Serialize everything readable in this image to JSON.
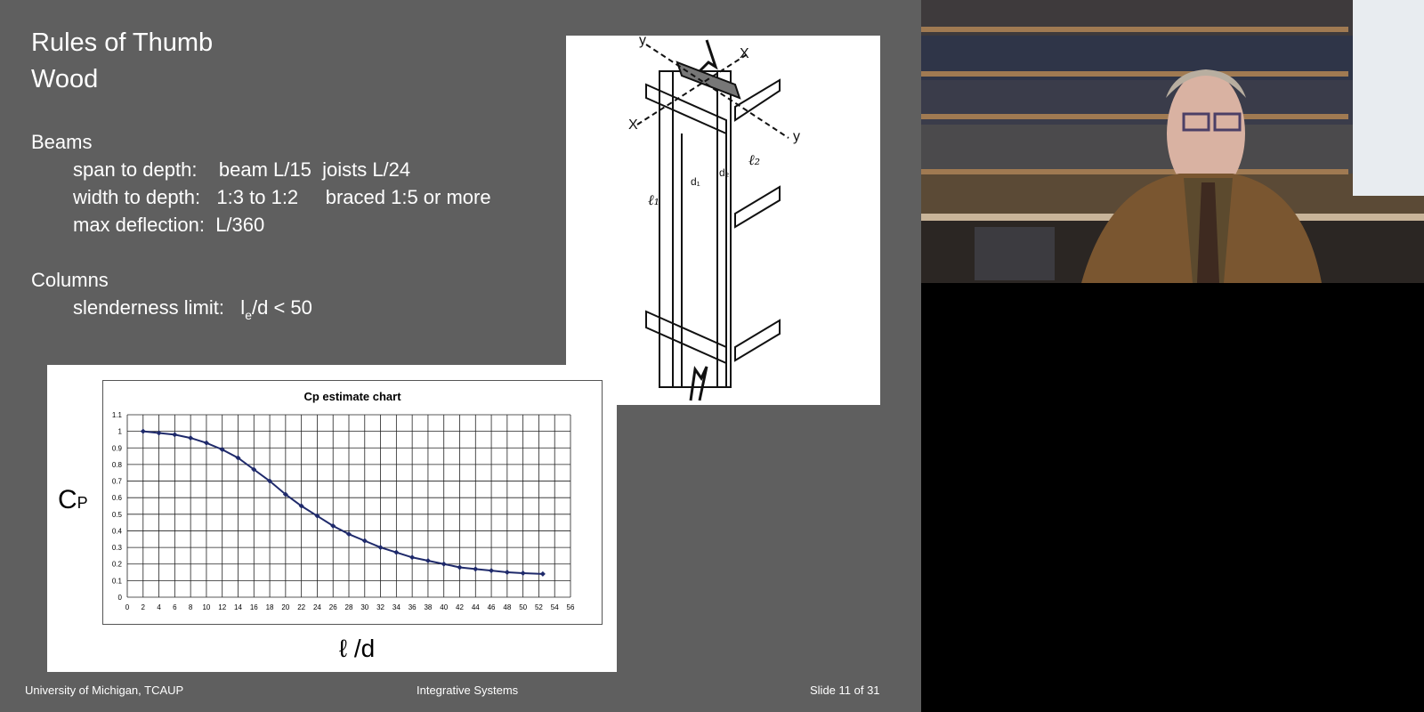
{
  "slide": {
    "title_line1": "Rules of Thumb",
    "title_line2": "Wood",
    "beams": {
      "heading": "Beams",
      "span_to_depth": "span to depth:    beam L/15  joists L/24",
      "width_to_depth": "width to depth:   1:3 to 1:2     braced 1:5 or more",
      "max_deflection": "max deflection:  L/360"
    },
    "columns": {
      "heading": "Columns",
      "slenderness_prefix": "slenderness limit:   l",
      "slenderness_sub": "e",
      "slenderness_suffix": "/d < 50"
    },
    "diagram_labels": {
      "x": "X",
      "y": "Y",
      "y2": "y",
      "l1": "ℓ₁",
      "l2": "ℓ₂",
      "d1": "d₁",
      "d2": "d₂"
    },
    "footer": {
      "left": "University of Michigan, TCAUP",
      "center": "Integrative Systems",
      "right": "Slide  11 of 31"
    }
  },
  "colors": {
    "slide_bg": "#5f5f5f",
    "series": "#1f2a6b"
  },
  "chart_data": {
    "type": "line",
    "title": "Cp estimate chart",
    "ylabel_main": "C",
    "ylabel_sub": "P",
    "xlabel": "ℓ /d",
    "xlim": [
      0,
      56
    ],
    "ylim": [
      0,
      1.1
    ],
    "xticks": [
      0,
      2,
      4,
      6,
      8,
      10,
      12,
      14,
      16,
      18,
      20,
      22,
      24,
      26,
      28,
      30,
      32,
      34,
      36,
      38,
      40,
      42,
      44,
      46,
      48,
      50,
      52,
      54,
      56
    ],
    "yticks": [
      0,
      0.1,
      0.2,
      0.3,
      0.4,
      0.5,
      0.6,
      0.7,
      0.8,
      0.9,
      1,
      1.1
    ],
    "grid": true,
    "series": [
      {
        "x": [
          2,
          4,
          6,
          8,
          10,
          12,
          14,
          16,
          18,
          20,
          22,
          24,
          26,
          28,
          30,
          32,
          34,
          36,
          38,
          40,
          42,
          44,
          46,
          48,
          50,
          52.5
        ],
        "y": [
          1.0,
          0.99,
          0.98,
          0.96,
          0.93,
          0.89,
          0.84,
          0.77,
          0.7,
          0.62,
          0.55,
          0.49,
          0.43,
          0.38,
          0.34,
          0.3,
          0.27,
          0.24,
          0.22,
          0.2,
          0.18,
          0.17,
          0.16,
          0.15,
          0.145,
          0.14
        ]
      }
    ]
  }
}
